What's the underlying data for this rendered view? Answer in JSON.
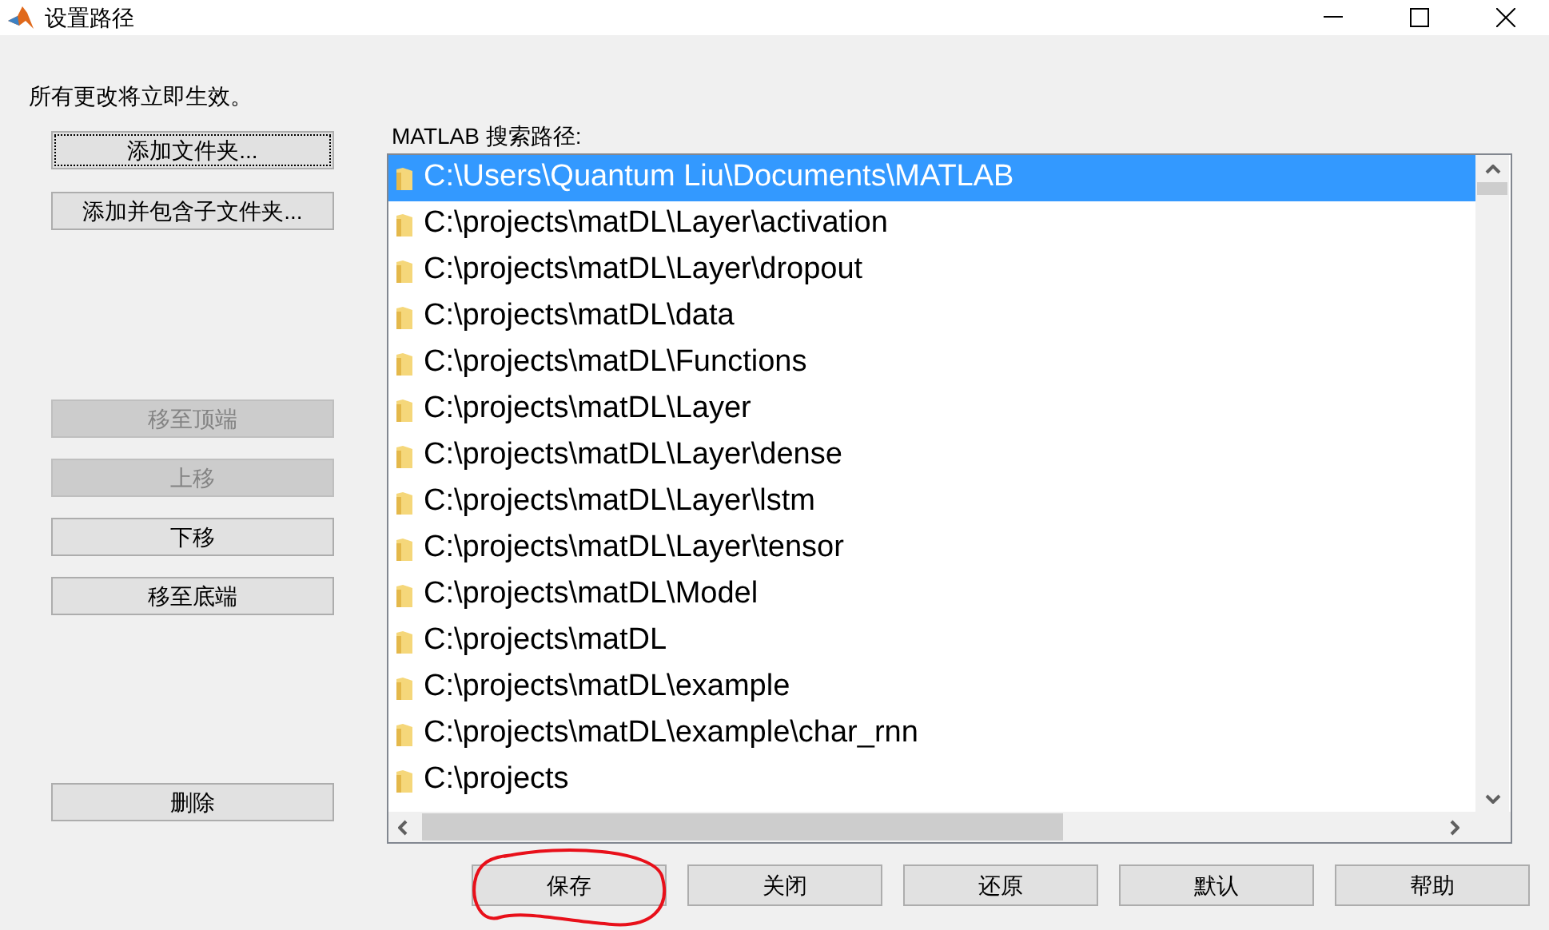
{
  "window": {
    "title": "设置路径"
  },
  "notice": "所有更改将立即生效。",
  "side_buttons": [
    {
      "label": "添加文件夹...",
      "disabled": false,
      "focused": true
    },
    {
      "label": "添加并包含子文件夹...",
      "disabled": false,
      "focused": false
    },
    {
      "label": "移至顶端",
      "disabled": true,
      "focused": false
    },
    {
      "label": "上移",
      "disabled": true,
      "focused": false
    },
    {
      "label": "下移",
      "disabled": false,
      "focused": false
    },
    {
      "label": "移至底端",
      "disabled": false,
      "focused": false
    },
    {
      "label": "删除",
      "disabled": false,
      "focused": false
    }
  ],
  "path_list": {
    "label": "MATLAB 搜索路径:",
    "items": [
      {
        "path": "C:\\Users\\Quantum Liu\\Documents\\MATLAB",
        "selected": true
      },
      {
        "path": "C:\\projects\\matDL\\Layer\\activation",
        "selected": false
      },
      {
        "path": "C:\\projects\\matDL\\Layer\\dropout",
        "selected": false
      },
      {
        "path": "C:\\projects\\matDL\\data",
        "selected": false
      },
      {
        "path": "C:\\projects\\matDL\\Functions",
        "selected": false
      },
      {
        "path": "C:\\projects\\matDL\\Layer",
        "selected": false
      },
      {
        "path": "C:\\projects\\matDL\\Layer\\dense",
        "selected": false
      },
      {
        "path": "C:\\projects\\matDL\\Layer\\lstm",
        "selected": false
      },
      {
        "path": "C:\\projects\\matDL\\Layer\\tensor",
        "selected": false
      },
      {
        "path": "C:\\projects\\matDL\\Model",
        "selected": false
      },
      {
        "path": "C:\\projects\\matDL",
        "selected": false
      },
      {
        "path": "C:\\projects\\matDL\\example",
        "selected": false
      },
      {
        "path": "C:\\projects\\matDL\\example\\char_rnn",
        "selected": false
      },
      {
        "path": "C:\\projects",
        "selected": false
      }
    ]
  },
  "bottom_buttons": [
    "保存",
    "关闭",
    "还原",
    "默认",
    "帮助"
  ]
}
